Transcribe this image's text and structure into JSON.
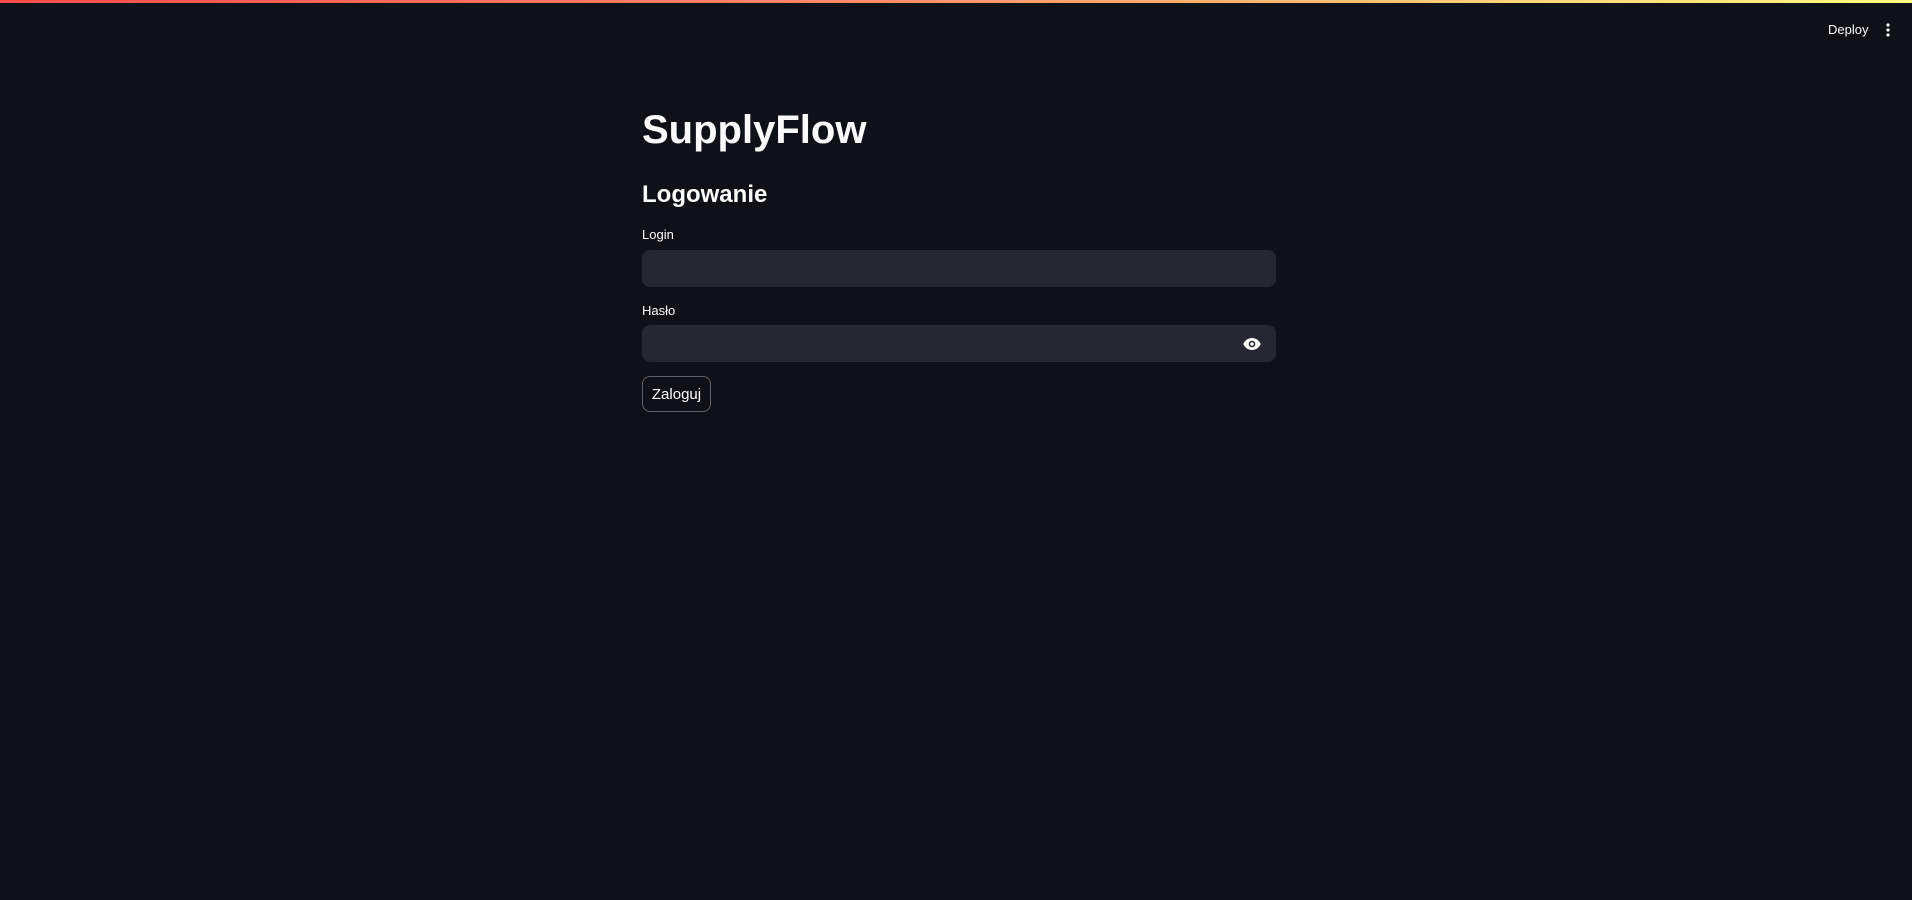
{
  "header": {
    "deploy_label": "Deploy",
    "menu_icon": "vertical-ellipsis-icon"
  },
  "main": {
    "title": "SupplyFlow",
    "subheader": "Logowanie",
    "login_field": {
      "label": "Login",
      "value": "",
      "placeholder": ""
    },
    "password_field": {
      "label": "Hasło",
      "value": "",
      "placeholder": "",
      "toggle_icon": "eye-icon"
    },
    "submit_label": "Zaloguj"
  },
  "colors": {
    "background": "#0e1117",
    "input_background": "#262730",
    "text": "#fafafa",
    "top_bar_gradient": [
      "#ff4b4b",
      "#fd8b68",
      "#fffd80"
    ]
  }
}
